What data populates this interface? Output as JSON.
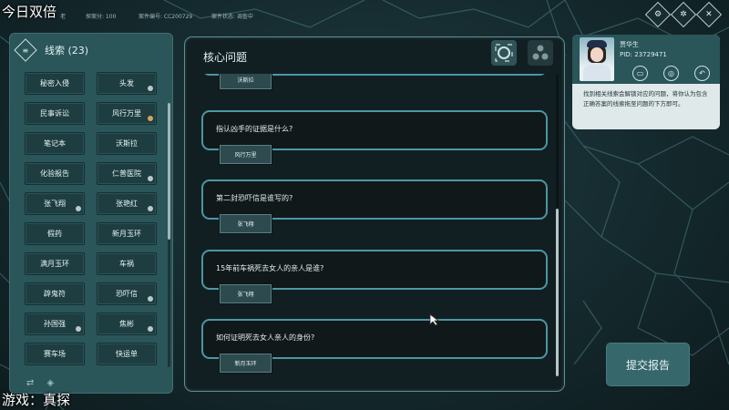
{
  "overlay": {
    "title": "今日双倍",
    "game_label": "游戏：真探"
  },
  "status": {
    "rank": "老",
    "detective_points": "探案分: 100",
    "case_number": "案件编号: CC200729",
    "case_status": "案件状态: 调查中"
  },
  "top_icons": [
    "settings-icon",
    "gear-icon",
    "close-icon"
  ],
  "clues": {
    "title": "线索 (23)",
    "items": [
      {
        "label": "秘密入侵",
        "dot": ""
      },
      {
        "label": "头发",
        "dot": "grey"
      },
      {
        "label": "民事诉讼",
        "dot": ""
      },
      {
        "label": "风行万里",
        "dot": "orange"
      },
      {
        "label": "笔记本",
        "dot": ""
      },
      {
        "label": "沃斯拉",
        "dot": ""
      },
      {
        "label": "化验报告",
        "dot": ""
      },
      {
        "label": "仁普医院",
        "dot": "grey"
      },
      {
        "label": "张飞翔",
        "dot": "grey"
      },
      {
        "label": "张艳红",
        "dot": "grey"
      },
      {
        "label": "假药",
        "dot": ""
      },
      {
        "label": "新月玉环",
        "dot": ""
      },
      {
        "label": "满月玉环",
        "dot": ""
      },
      {
        "label": "车祸",
        "dot": ""
      },
      {
        "label": "辟鬼符",
        "dot": ""
      },
      {
        "label": "恐吓信",
        "dot": "grey"
      },
      {
        "label": "孙国强",
        "dot": "grey"
      },
      {
        "label": "焦彬",
        "dot": "grey"
      },
      {
        "label": "赛车场",
        "dot": ""
      },
      {
        "label": "快运单",
        "dot": ""
      }
    ]
  },
  "core": {
    "title": "核心问题",
    "partial_answer": "沃斯拉",
    "questions": [
      {
        "text": "指认凶手的证据是什么?",
        "answer": "风行万里"
      },
      {
        "text": "第二封恐吓信是谁写的?",
        "answer": "张飞翔"
      },
      {
        "text": "15年前车祸死去女人的亲人是谁?",
        "answer": "张飞翔"
      },
      {
        "text": "如何证明死去女人亲人的身份?",
        "answer": "新月玉环"
      }
    ]
  },
  "character": {
    "name": "贾华生",
    "pid": "PID: 23729471",
    "description": "找到相关线索会解锁对应的问题，将你认为包含正确答案的线索拖至问题的下方即可。"
  },
  "submit_label": "提交报告",
  "colors": {
    "panel": "#2a5559",
    "card_border": "#4b97a3",
    "background": "#152a2e"
  }
}
